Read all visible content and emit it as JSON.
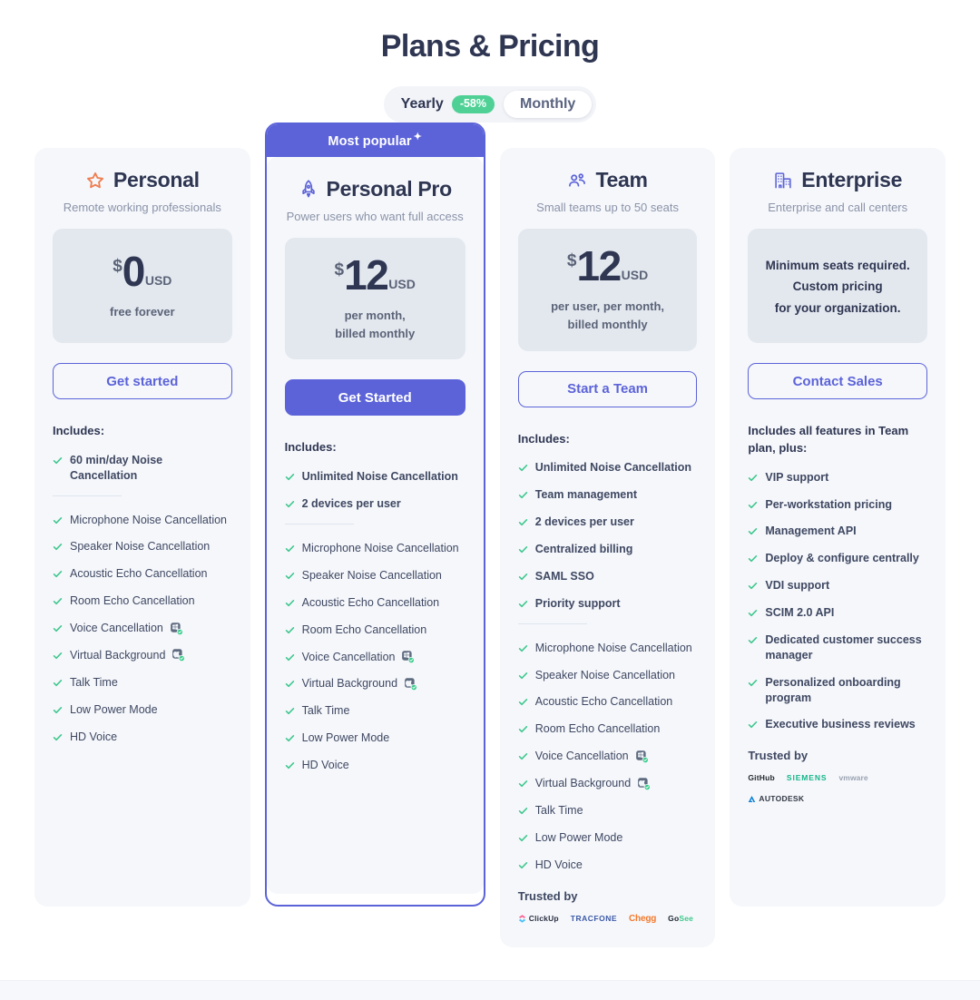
{
  "header": {
    "title": "Plans & Pricing",
    "billing_toggle": {
      "options": [
        {
          "label": "Yearly",
          "badge": "-58%",
          "selected": false
        },
        {
          "label": "Monthly",
          "badge": null,
          "selected": true
        }
      ]
    }
  },
  "colors": {
    "accent": "#5c63d8",
    "check_green": "#3fc78e",
    "badge_green": "#4fd196",
    "star_orange": "#ef7d4e",
    "text_dark": "#2f3652",
    "card_bg": "#f5f7fb",
    "price_bg": "#e3e8ef"
  },
  "plans": [
    {
      "id": "personal",
      "icon": "star-icon",
      "name": "Personal",
      "tagline": "Remote working professionals",
      "currency": "$",
      "amount": "0",
      "unit": "USD",
      "price_sub": [
        "free forever"
      ],
      "cta": "Get started",
      "cta_style": "outline",
      "featured": false,
      "banner": null,
      "includes_label": "Includes:",
      "primary_features": [
        {
          "text": "60 min/day Noise Cancellation",
          "badges": []
        }
      ],
      "secondary_features": [
        {
          "text": "Microphone Noise Cancellation",
          "badges": []
        },
        {
          "text": "Speaker Noise Cancellation",
          "badges": []
        },
        {
          "text": "Acoustic Echo Cancellation",
          "badges": []
        },
        {
          "text": "Room Echo Cancellation",
          "badges": []
        },
        {
          "text": "Voice Cancellation",
          "badges": [
            "windows"
          ]
        },
        {
          "text": "Virtual Background",
          "badges": [
            "apple"
          ]
        },
        {
          "text": "Talk Time",
          "badges": []
        },
        {
          "text": "Low Power Mode",
          "badges": []
        },
        {
          "text": "HD Voice",
          "badges": []
        }
      ],
      "trusted_by": null,
      "logos": []
    },
    {
      "id": "personal-pro",
      "icon": "rocket-icon",
      "name": "Personal Pro",
      "tagline": "Power users who want full access",
      "currency": "$",
      "amount": "12",
      "unit": "USD",
      "price_sub": [
        "per month,",
        "billed monthly"
      ],
      "cta": "Get Started",
      "cta_style": "solid",
      "featured": true,
      "banner": "Most popular",
      "includes_label": "Includes:",
      "primary_features": [
        {
          "text": "Unlimited Noise Cancellation",
          "badges": []
        },
        {
          "text": "2 devices per user",
          "badges": []
        }
      ],
      "secondary_features": [
        {
          "text": "Microphone Noise Cancellation",
          "badges": []
        },
        {
          "text": "Speaker Noise Cancellation",
          "badges": []
        },
        {
          "text": "Acoustic Echo Cancellation",
          "badges": []
        },
        {
          "text": "Room Echo Cancellation",
          "badges": []
        },
        {
          "text": "Voice Cancellation",
          "badges": [
            "windows"
          ]
        },
        {
          "text": "Virtual Background",
          "badges": [
            "apple"
          ]
        },
        {
          "text": "Talk Time",
          "badges": []
        },
        {
          "text": "Low Power Mode",
          "badges": []
        },
        {
          "text": "HD Voice",
          "badges": []
        }
      ],
      "trusted_by": null,
      "logos": []
    },
    {
      "id": "team",
      "icon": "team-icon",
      "name": "Team",
      "tagline": "Small teams up to 50 seats",
      "currency": "$",
      "amount": "12",
      "unit": "USD",
      "price_sub": [
        "per user, per month,",
        "billed monthly"
      ],
      "cta": "Start a Team",
      "cta_style": "outline",
      "featured": false,
      "banner": null,
      "includes_label": "Includes:",
      "primary_features": [
        {
          "text": "Unlimited Noise Cancellation",
          "badges": []
        },
        {
          "text": "Team management",
          "badges": []
        },
        {
          "text": "2 devices per user",
          "badges": []
        },
        {
          "text": "Centralized billing",
          "badges": []
        },
        {
          "text": "SAML SSO",
          "badges": []
        },
        {
          "text": "Priority support",
          "badges": []
        }
      ],
      "secondary_features": [
        {
          "text": "Microphone Noise Cancellation",
          "badges": []
        },
        {
          "text": "Speaker Noise Cancellation",
          "badges": []
        },
        {
          "text": "Acoustic Echo Cancellation",
          "badges": []
        },
        {
          "text": "Room Echo Cancellation",
          "badges": []
        },
        {
          "text": "Voice Cancellation",
          "badges": [
            "windows"
          ]
        },
        {
          "text": "Virtual Background",
          "badges": [
            "apple"
          ]
        },
        {
          "text": "Talk Time",
          "badges": []
        },
        {
          "text": "Low Power Mode",
          "badges": []
        },
        {
          "text": "HD Voice",
          "badges": []
        }
      ],
      "trusted_by": "Trusted by",
      "logos": [
        "ClickUp",
        "TRACFONE",
        "Chegg",
        "GoSee"
      ]
    },
    {
      "id": "enterprise",
      "icon": "building-icon",
      "name": "Enterprise",
      "tagline": "Enterprise and call centers",
      "currency": null,
      "amount": null,
      "unit": null,
      "price_custom": [
        "Minimum seats required.",
        "Custom pricing",
        "for your organization."
      ],
      "price_sub": [],
      "cta": "Contact Sales",
      "cta_style": "outline",
      "featured": false,
      "banner": null,
      "includes_label": "Includes all features in Team plan, plus:",
      "primary_features": [
        {
          "text": "VIP support",
          "badges": []
        },
        {
          "text": "Per-workstation pricing",
          "badges": []
        },
        {
          "text": "Management API",
          "badges": []
        },
        {
          "text": "Deploy & configure centrally",
          "badges": []
        },
        {
          "text": "VDI support",
          "badges": []
        },
        {
          "text": "SCIM 2.0 API",
          "badges": []
        },
        {
          "text": "Dedicated customer success manager",
          "badges": []
        },
        {
          "text": "Personalized onboarding program",
          "badges": []
        },
        {
          "text": "Executive business reviews",
          "badges": []
        }
      ],
      "secondary_features": [],
      "trusted_by": "Trusted by",
      "logos": [
        "GitHub",
        "SIEMENS",
        "vmware",
        "AUTODESK"
      ]
    }
  ]
}
